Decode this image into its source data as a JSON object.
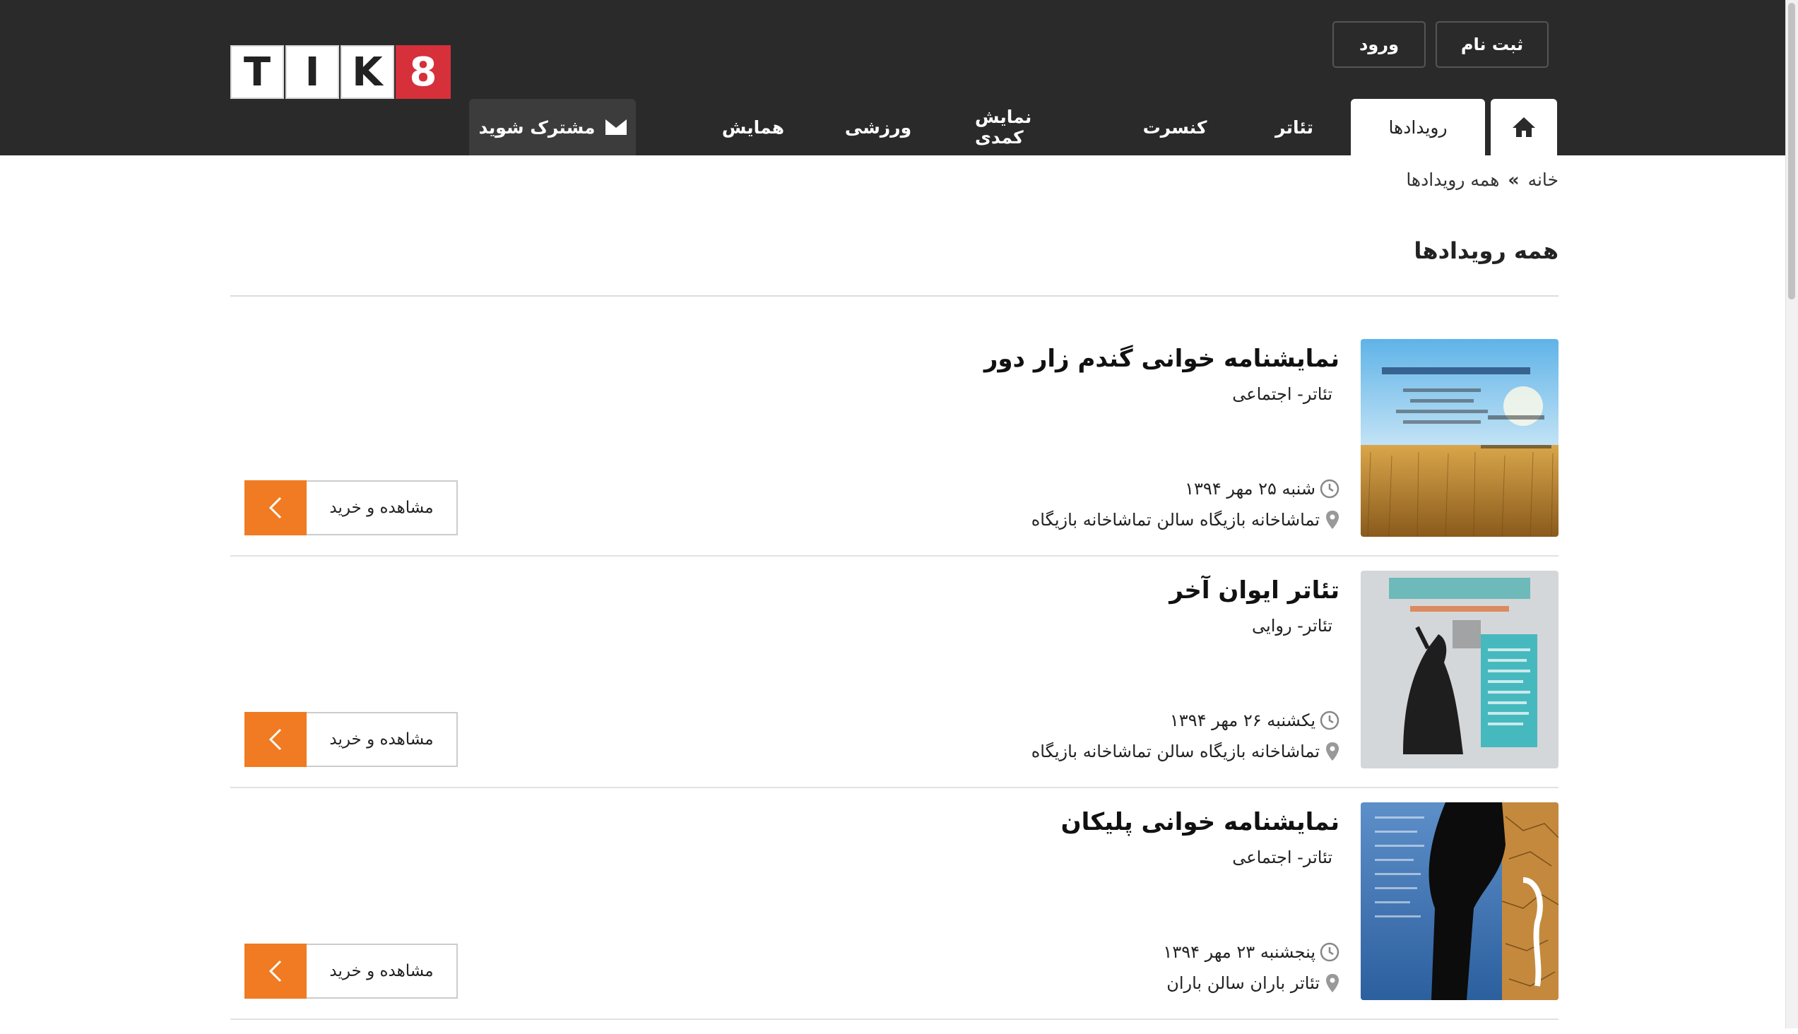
{
  "header": {
    "logo_letters": [
      "T",
      "I",
      "K",
      "8"
    ],
    "register_label": "ثبت نام",
    "login_label": "ورود"
  },
  "nav": {
    "home_icon": "home-icon",
    "events": "رویدادها",
    "theatre": "تئاتر",
    "concert": "کنسرت",
    "comedy": "نمایش کمدی",
    "sport": "ورزشی",
    "conference": "همایش",
    "subscribe": "مشترک شوید",
    "subscribe_icon": "envelope-icon"
  },
  "breadcrumb": {
    "home": "خانه",
    "separator": "»",
    "current": "همه رویدادها"
  },
  "page_title": "همه رویدادها",
  "events": [
    {
      "title": "نمایشنامه خوانی گندم زار دور",
      "category": "تئاتر- اجتماعی",
      "date": "شنبه ۲۵ مهر ۱۳۹۴",
      "venue": "تماشاخانه بازیگاه سالن تماشاخانه بازیگاه",
      "button": "مشاهده و خرید"
    },
    {
      "title": "تئاتر ایوان آخر",
      "category": "تئاتر- روایی",
      "date": "یکشنبه ۲۶ مهر ۱۳۹۴",
      "venue": "تماشاخانه بازیگاه سالن تماشاخانه بازیگاه",
      "button": "مشاهده و خرید"
    },
    {
      "title": "نمایشنامه خوانی پلیکان",
      "category": "تئاتر- اجتماعی",
      "date": "پنجشنبه ۲۳ مهر ۱۳۹۴",
      "venue": "تئاتر باران سالن باران",
      "button": "مشاهده و خرید"
    }
  ],
  "colors": {
    "header_bg": "#2a2a2a",
    "logo_accent": "#d6303a",
    "button_accent": "#f07b22"
  }
}
